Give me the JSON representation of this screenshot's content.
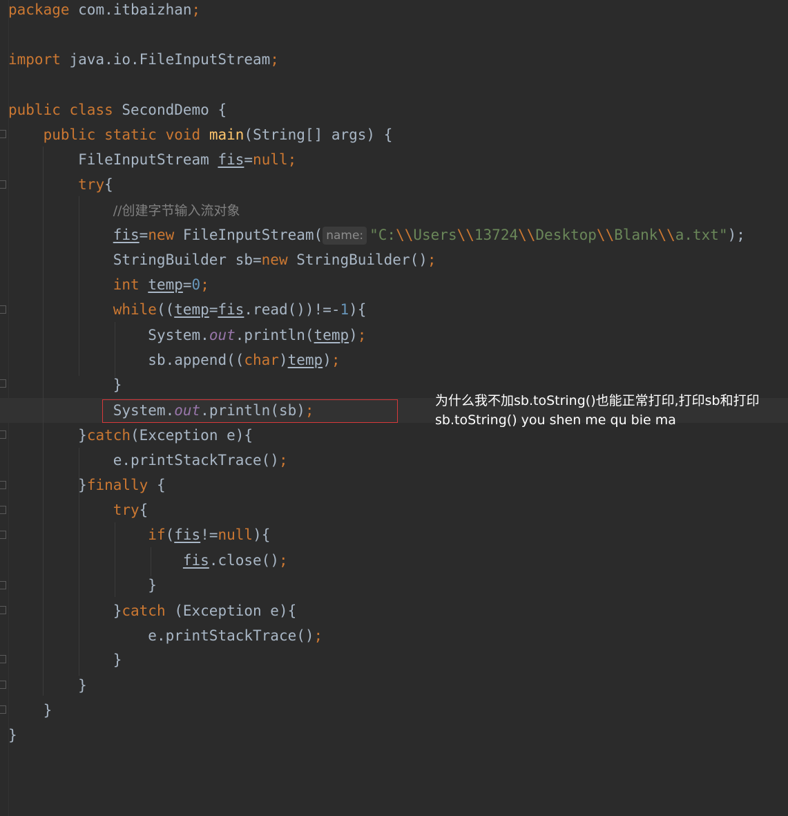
{
  "colors": {
    "background": "#2b2b2b",
    "keyword": "#cc7832",
    "method_decl": "#ffc66d",
    "text": "#a9b7c6",
    "string": "#6a8759",
    "number": "#6897bb",
    "static_field": "#9876aa",
    "comment": "#808080",
    "highlight_box": "#d8393b"
  },
  "code": {
    "pkg_kw": "package",
    "pkg_name": " com.itbaizhan",
    "semi": ";",
    "imp_kw": "import",
    "imp_name": " java.io.FileInputStream",
    "public": "public",
    "class": "class",
    "class_name": " SecondDemo {",
    "static": "static",
    "void": "void",
    "main": "main",
    "main_args": "(String[] args) {",
    "type_fis": "FileInputStream ",
    "var_fis": "fis",
    "eq": "=",
    "null": "null",
    "try": "try",
    "brace_open": "{",
    "comment": "//创建字节输入流对象",
    "new": "new",
    "fis_ctor": " FileInputStream(",
    "hint_name": "name:",
    "str_open": "\"C:",
    "str_users": "Users",
    "str_num": "13724",
    "str_desktop": "Desktop",
    "str_blank": "Blank",
    "str_file": "a.txt\"",
    "esc": "\\\\",
    "close_paren_semi": ");",
    "sb_type": "StringBuilder sb=",
    "sb_ctor": " StringBuilder()",
    "int": "int",
    "var_temp": "temp",
    "zero": "0",
    "while": "while",
    "while_open": "((",
    "read_call": ".read())!=-",
    "one": "1",
    "while_close": "){",
    "system": "System.",
    "out": "out",
    "println_open": ".println(",
    "sb_append": "sb.append((",
    "char": "char",
    "paren_close": ")",
    "close_brace": "}",
    "println_sb": ".println(sb)",
    "catch": "catch",
    "exception_e": "(Exception e){",
    "catch_space": " (Exception e){",
    "print_stack": "e.printStackTrace()",
    "finally": "finally",
    "finally_open": " {",
    "if": "if",
    "if_open": "(",
    "neq": "!=",
    "if_close": "){",
    "close_call": ".close()"
  },
  "annotation": {
    "question": "为什么我不加sb.toString()也能正常打印,打印sb和打印sb.toString() you shen me qu bie ma"
  }
}
